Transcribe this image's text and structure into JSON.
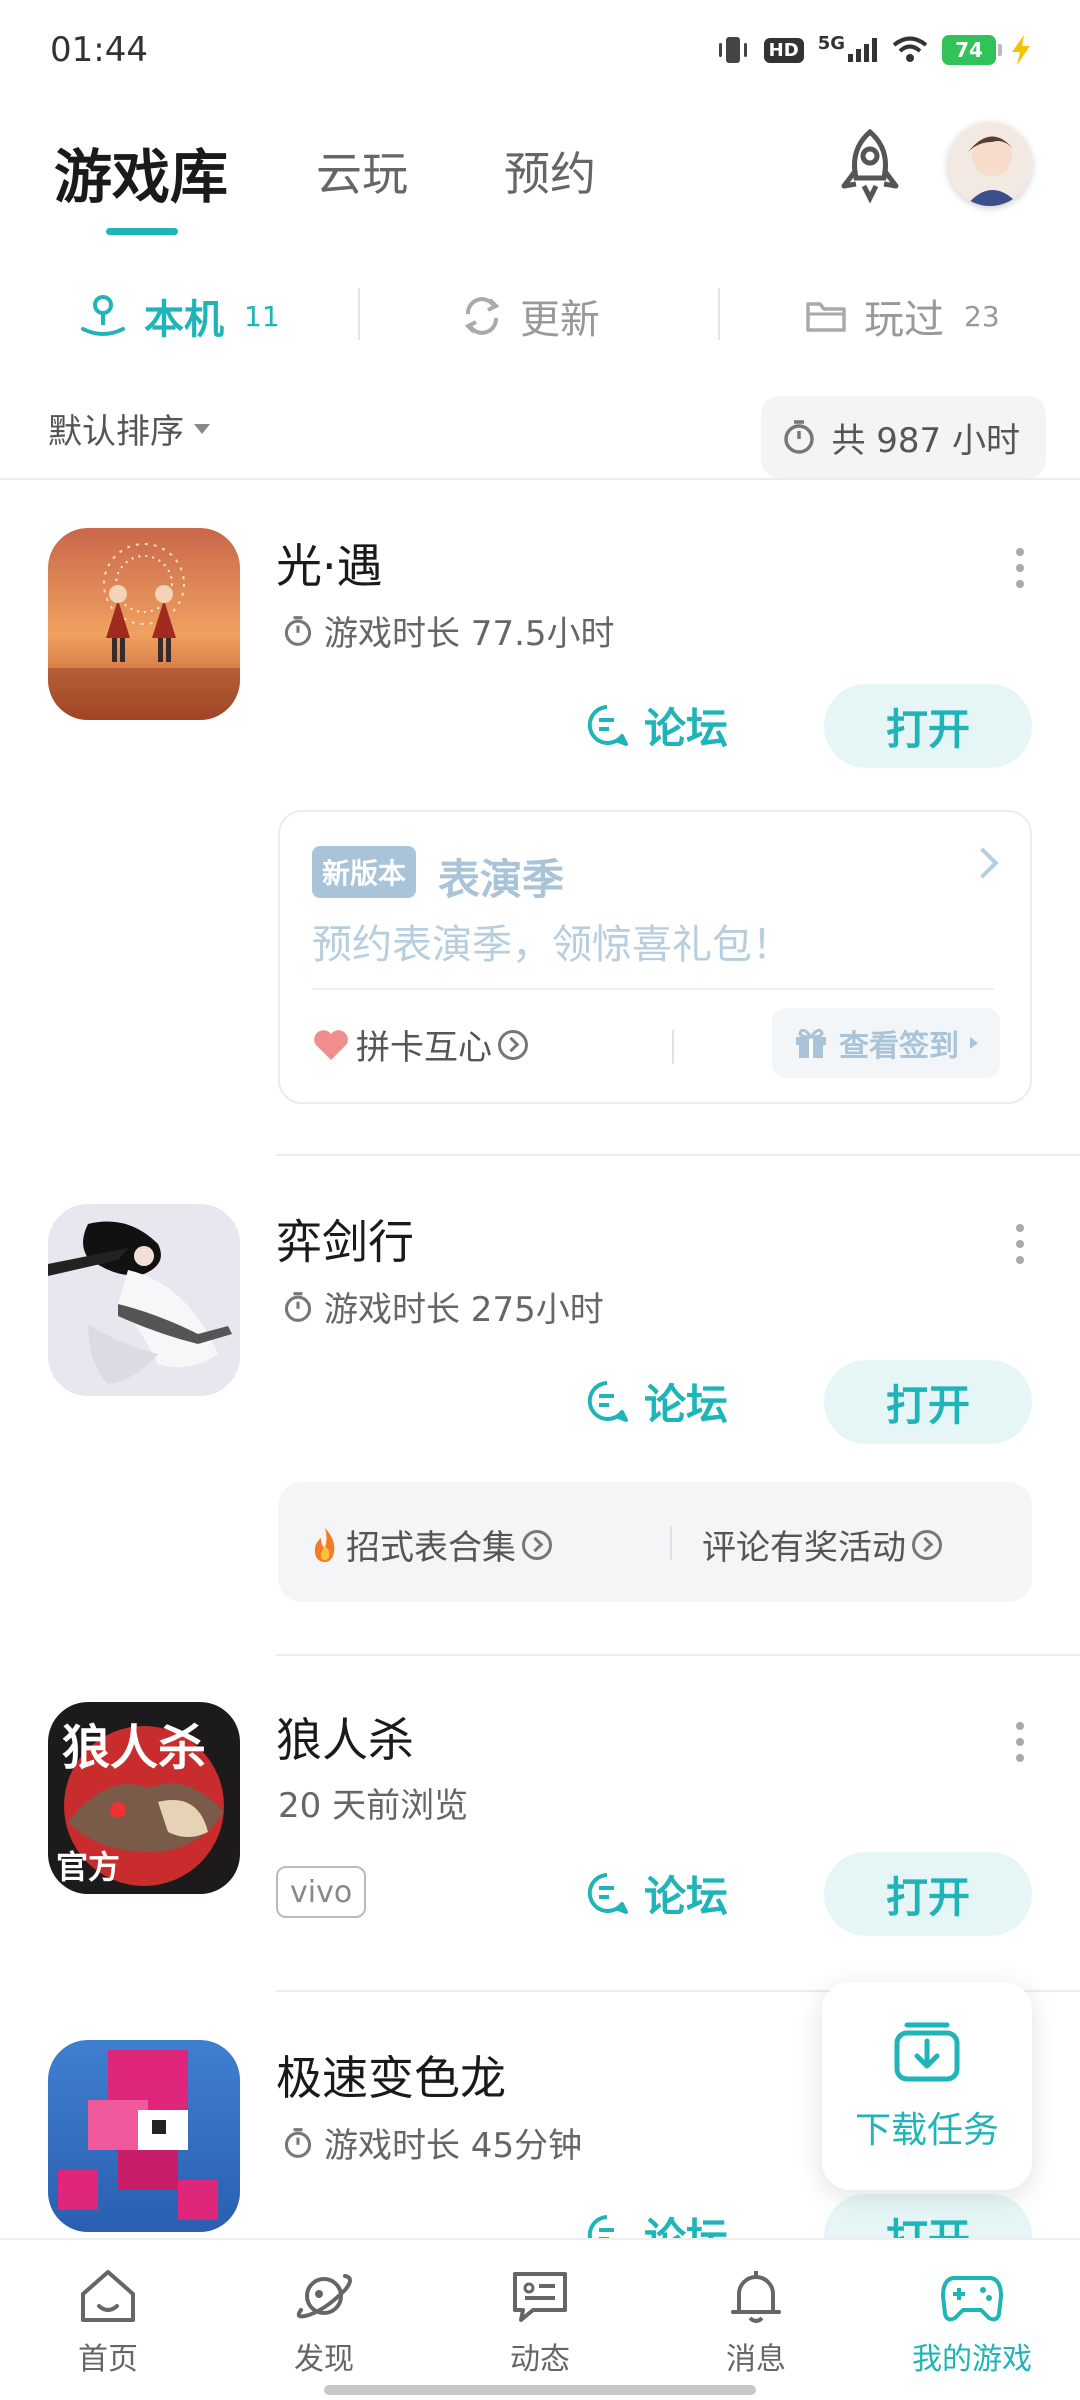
{
  "status_bar": {
    "time": "01:44",
    "hd": "HD",
    "network": "5G",
    "battery": "74"
  },
  "top_tabs": [
    {
      "label": "游戏库",
      "active": true
    },
    {
      "label": "云玩"
    },
    {
      "label": "预约"
    }
  ],
  "sub_tabs": [
    {
      "label": "本机",
      "count": "11",
      "active": true
    },
    {
      "label": "更新",
      "count": ""
    },
    {
      "label": "玩过",
      "count": "23"
    }
  ],
  "sort": {
    "label": "默认排序"
  },
  "total_playtime": "共 987 小时",
  "games": [
    {
      "title": "光·遇",
      "subtitle": "游戏时长 77.5小时",
      "forum_label": "论坛",
      "open_label": "打开"
    },
    {
      "title": "弈剑行",
      "subtitle": "游戏时长 275小时",
      "forum_label": "论坛",
      "open_label": "打开"
    },
    {
      "title": "狼人杀",
      "subtitle": "20 天前浏览",
      "tag": "vivo",
      "icon_text": "狼人杀",
      "icon_badge": "官方",
      "forum_label": "论坛",
      "open_label": "打开"
    },
    {
      "title": "极速变色龙",
      "subtitle": "游戏时长 45分钟",
      "forum_label": "论坛",
      "open_label": "打开"
    }
  ],
  "promo": {
    "badge": "新版本",
    "title": "表演季",
    "subtitle": "预约表演季，领惊喜礼包！",
    "link": "拼卡互心",
    "checkin": "查看签到"
  },
  "game2_links": {
    "left": "招式表合集",
    "right": "评论有奖活动"
  },
  "floating_button": {
    "label": "下载任务"
  },
  "bottom_nav": [
    {
      "label": "首页",
      "icon": "home-icon"
    },
    {
      "label": "发现",
      "icon": "planet-icon"
    },
    {
      "label": "动态",
      "icon": "chat-icon"
    },
    {
      "label": "消息",
      "icon": "bell-icon"
    },
    {
      "label": "我的游戏",
      "icon": "gamepad-icon",
      "active": true
    }
  ],
  "colors": {
    "accent": "#1fb5b8",
    "promo_blue": "#a9c3d8"
  }
}
